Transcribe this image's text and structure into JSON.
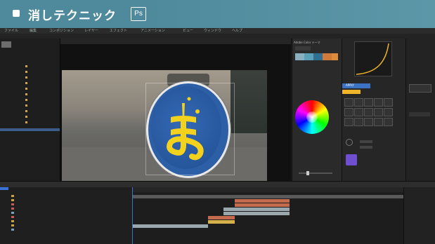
{
  "banner": {
    "title": "消しテクニック",
    "badge": "Ps"
  },
  "menubar": {
    "items": [
      "ファイル",
      "編集",
      "コンポジション",
      "レイヤー",
      "エフェクト",
      "アニメーション",
      "ビュー",
      "ウィンドウ",
      "ヘルプ"
    ]
  },
  "color_panel": {
    "tab_label": "Adobe Color テーマ",
    "swatch_colors": [
      "#8ab0c0",
      "#5aa0b8",
      "#2f6f8f",
      "#d07a3a",
      "#e08b3c"
    ],
    "apply_label": "APPLY"
  },
  "accent": {
    "banner": "#4f8a9c",
    "sign_blue": "#2d5fa6",
    "sign_yellow": "#f2d21c",
    "playhead": "#3a73d8",
    "apply": "#3b72c4",
    "highlight": "#f0b429"
  },
  "viewer": {
    "sign_character": "ま"
  }
}
